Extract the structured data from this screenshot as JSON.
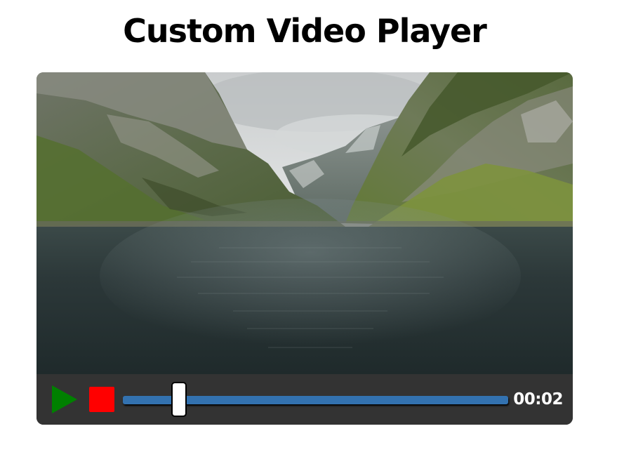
{
  "page": {
    "title": "Custom Video Player"
  },
  "player": {
    "controls": {
      "play_icon": "play-icon",
      "stop_icon": "stop-icon",
      "play_color": "#008000",
      "stop_color": "#ff0000",
      "seek_color": "#3372b0",
      "progress_fraction": 0.13,
      "current_time": "00:02"
    }
  }
}
